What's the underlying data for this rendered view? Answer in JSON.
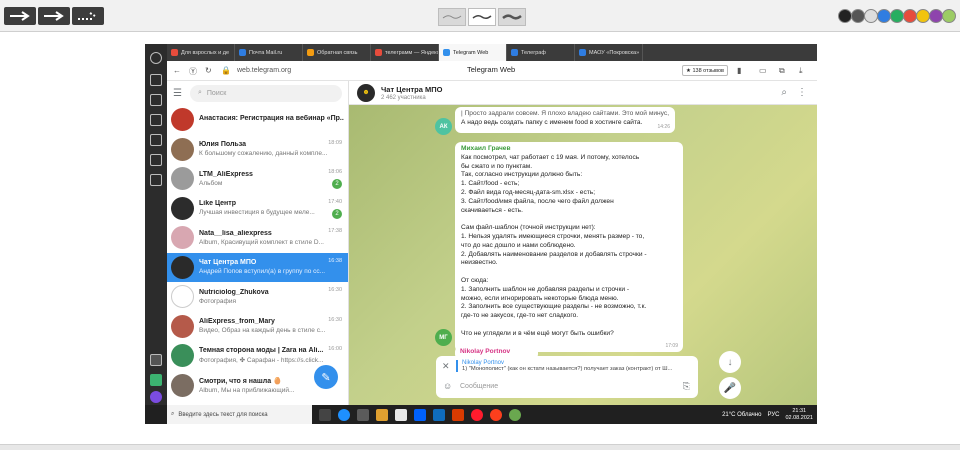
{
  "browser": {
    "tabs": [
      {
        "label": "Для взрослых и де",
        "color": "#e74c3c"
      },
      {
        "label": "Почта Mail.ru",
        "color": "#2f7de1"
      },
      {
        "label": "Обратная связь",
        "color": "#f39c12"
      },
      {
        "label": "телеграмм — Яндекс",
        "color": "#e74c3c"
      },
      {
        "label": "Telegram Web",
        "color": "#3390ec"
      },
      {
        "label": "Телеграф",
        "color": "#2f7de1"
      },
      {
        "label": "МАОУ «Покровска»",
        "color": "#2f7de1"
      }
    ],
    "url": "web.telegram.org",
    "page_title": "Telegram Web",
    "reviews": "★ 138 отзывов"
  },
  "sidebar": {
    "search_placeholder": "Поиск",
    "chats": [
      {
        "name": "Анастасия: Регистрация на вебинар «Пр...",
        "preview": "",
        "time": "",
        "badge": "",
        "avatar_color": "#c0392b",
        "initials": ""
      },
      {
        "name": "Юлия Польза",
        "preview": "К большому сожалению, данный компле...",
        "time": "18:09",
        "badge": "",
        "avatar_color": "#8e6e53",
        "initials": ""
      },
      {
        "name": "LTM_AliExpress",
        "preview": "Альбом",
        "time": "18:06",
        "badge": "2",
        "avatar_color": "#9b9b9b",
        "initials": ""
      },
      {
        "name": "Like Центр",
        "preview": "Лучшая инвестиция в будущее меле...",
        "time": "17:40",
        "badge": "2",
        "avatar_color": "#2c2c2c",
        "initials": ""
      },
      {
        "name": "Nata__lisa_aliexpress",
        "preview": "Album, Красивущий комплект в стиле D...",
        "time": "17:38",
        "badge": "",
        "avatar_color": "#d8a7b1",
        "initials": ""
      },
      {
        "name": "Чат Центра МПО",
        "preview": "Андрей Попов вступил(а) в группу по сс...",
        "time": "16:38",
        "badge": "",
        "avatar_color": "#2a2a2a",
        "initials": ""
      },
      {
        "name": "Nutriciolog_Zhukova",
        "preview": "Фотография",
        "time": "16:30",
        "badge": "",
        "avatar_color": "#ffffff",
        "initials": ""
      },
      {
        "name": "AliExpress_from_Mary",
        "preview": "Видео, Образ на каждый день в стиле с...",
        "time": "16:30",
        "badge": "",
        "avatar_color": "#b55a4a",
        "initials": ""
      },
      {
        "name": "Темная сторона моды | Zara на Ali...",
        "preview": "Фотография, ✤ Сарафан - https://s.click...",
        "time": "16:00",
        "badge": "",
        "avatar_color": "#3a8f5a",
        "initials": ""
      },
      {
        "name": "Смотри, что я нашла 🥚",
        "preview": "Album, Мы на приближающий...",
        "time": "",
        "badge": "",
        "avatar_color": "#7b6d62",
        "initials": ""
      }
    ]
  },
  "chat": {
    "title": "Чат Центра МПО",
    "subtitle": "2 462 участника",
    "msg1": {
      "line1": "| Просто задрали совсем. Я плохо владею сайтами. Это мой минус,...",
      "line2": "А надо ведь создать папку с именем food в хостинге сайта.",
      "time": "14:26",
      "avatar": "АК"
    },
    "msg2": {
      "sender": "Михаил Грачев",
      "lines": [
        "Как посмотрел, чат работает с 19 мая. И потому, хотелось",
        "бы сжато и по пунктам.",
        "Так, согласно инструкции должно быть:",
        "1. Сайт/food - есть;",
        "2. Файл вида год-месяц-дата-sm.xlsx - есть;",
        "3. Сайт/food/имя файла, после чего файл должен",
        "скачиваеться - есть.",
        "",
        "Сам файл-шаблон (точной инструкции нет):",
        "1. Нельзя удалять имеющиеся строчки, менять размер - то,",
        "что до нас дошло и нами соблюдено.",
        "2. Добавлять наименование разделов и добавлять строчки -",
        "неизвестно.",
        "",
        "От сюда:",
        "1. Заполнить шаблон не добавляя разделы и строчки -",
        "можно, если игнорировать некоторые блюда меню.",
        "2. Заполнить все существующие разделы - не возможно, т.к.",
        "где-то не закусок, где-то нет сладкого.",
        "",
        "Что не углядели и в чём ещё могут быть ошибки?"
      ],
      "time": "17:09",
      "avatar": "МГ"
    },
    "msg3": {
      "sender": "Nikolay Portnov"
    },
    "reply": {
      "name": "Nikolay Portnov",
      "text": "1) \"Монополист\" (как он кстати называется?) получает заказ (контракт) от Ш..."
    },
    "input_placeholder": "Сообщение"
  },
  "taskbar": {
    "search_text": "Введите здесь текст для поиска",
    "weather": "21°C Облачно",
    "lang": "РУС",
    "time": "21:31",
    "date": "02.08.2021"
  },
  "toolbar": {
    "swatches": [
      "#222222",
      "#555555",
      "#dddddd",
      "#2f7de1",
      "#27ae60",
      "#e74c3c",
      "#f1c40f",
      "#8e44ad",
      "#9ccc65"
    ]
  }
}
